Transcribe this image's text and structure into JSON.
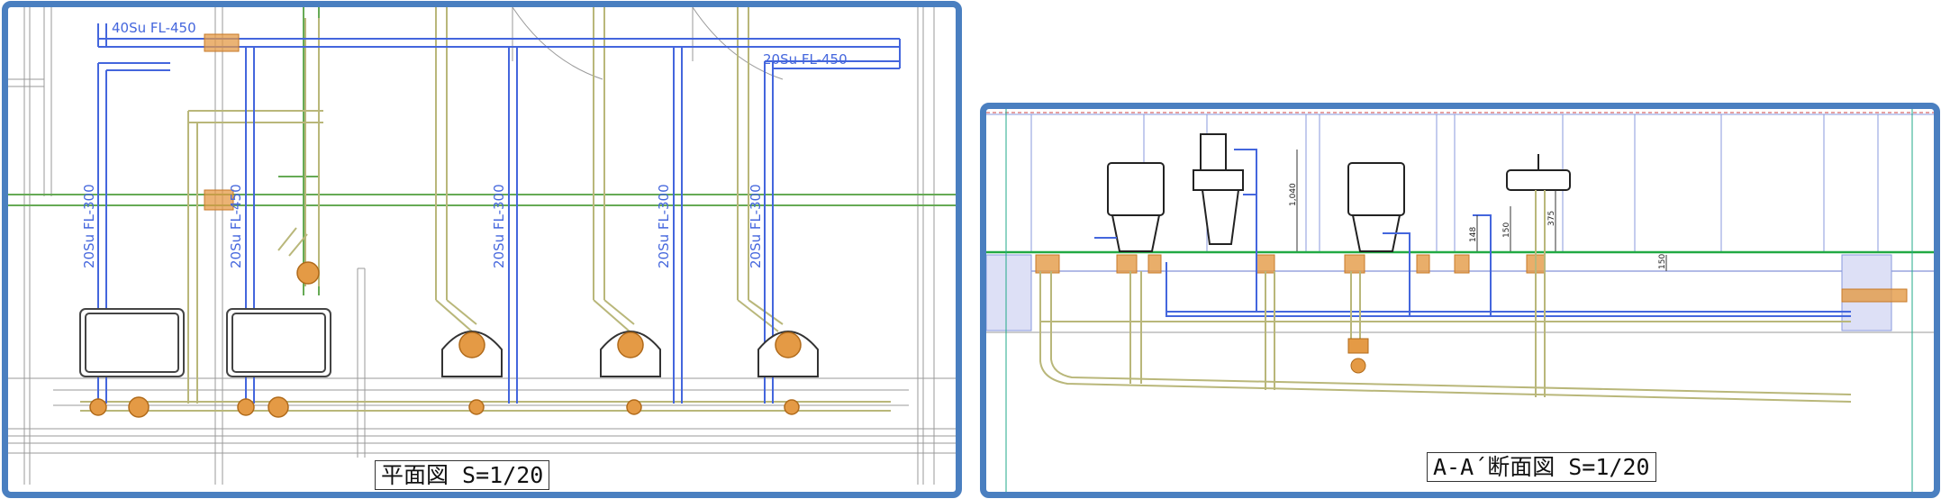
{
  "plan": {
    "caption": "平面図 S=1/20",
    "pipe_labels": [
      "40Su FL-450",
      "20Su FL-450",
      "20Su FL-300",
      "20Su FL-450",
      "20Su FL-300",
      "20Su FL-300",
      "20Su FL-300"
    ]
  },
  "section": {
    "caption": "A-A´断面図 S=1/20",
    "dims": [
      "1,040",
      "148",
      "150",
      "375",
      "150"
    ]
  },
  "colors": {
    "frame": "#4a7fc0",
    "supply": "#4466dd",
    "drain": "#b9b77a",
    "hot": "#66aa55",
    "sleeve": "#e49a45"
  }
}
